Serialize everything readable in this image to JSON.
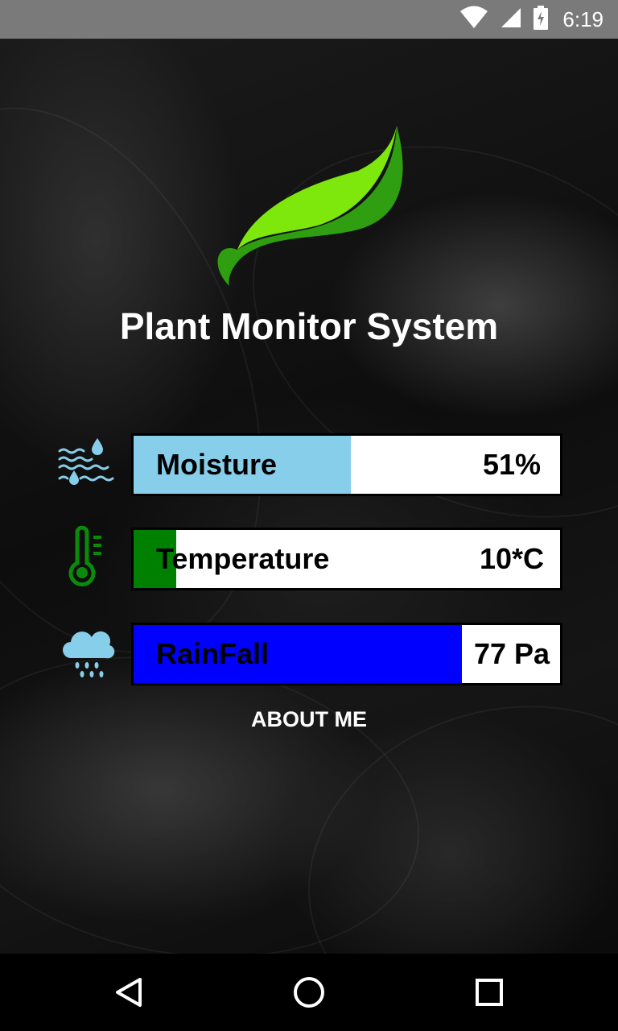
{
  "status_bar": {
    "time": "6:19",
    "icons": [
      "wifi-icon",
      "cell-signal-icon",
      "battery-charging-icon"
    ]
  },
  "app": {
    "title": "Plant Monitor System",
    "logo_icon": "leaf-logo-icon",
    "colors": {
      "leaf_light": "#7ee80c",
      "leaf_dark": "#2f9e10"
    }
  },
  "sensors": [
    {
      "label": "Moisture",
      "value": "51%",
      "fill_fraction": 0.51,
      "fill_color": "#87ceeb",
      "icon": "water-drops-icon"
    },
    {
      "label": "Temperature",
      "value": "10*C",
      "fill_fraction": 0.1,
      "fill_color": "#008000",
      "icon": "thermometer-icon"
    },
    {
      "label": "RainFall",
      "value": "77 Pa",
      "fill_fraction": 0.77,
      "fill_color": "#0000ff",
      "icon": "rain-cloud-icon"
    }
  ],
  "about_label": "ABOUT ME",
  "nav": {
    "icons": [
      "back-icon",
      "home-icon",
      "recents-icon"
    ]
  }
}
